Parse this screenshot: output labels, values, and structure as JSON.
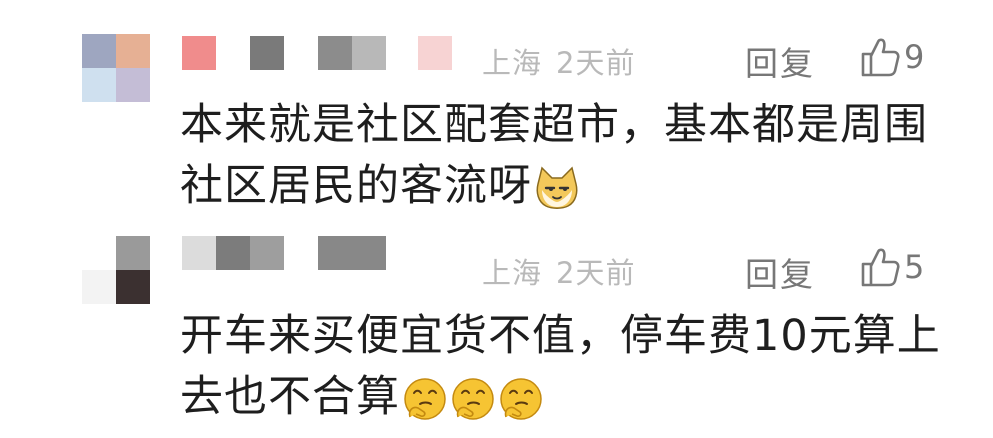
{
  "comments": [
    {
      "location": "上海",
      "time": "2天前",
      "reply_label": "回复",
      "likes": "9",
      "text": "本来就是社区配套超市，基本都是周围社区居民的客流呀",
      "emoji": "cat-face-emoji"
    },
    {
      "location": "上海",
      "time": "2天前",
      "reply_label": "回复",
      "likes": "5",
      "text": "开车来买便宜货不值，停车费10元算上去也不合算",
      "emoji": "hmm-face-emoji"
    }
  ],
  "colors": {
    "meta": "#b9b9b9",
    "action": "#777777",
    "text": "#1e1e1e"
  }
}
